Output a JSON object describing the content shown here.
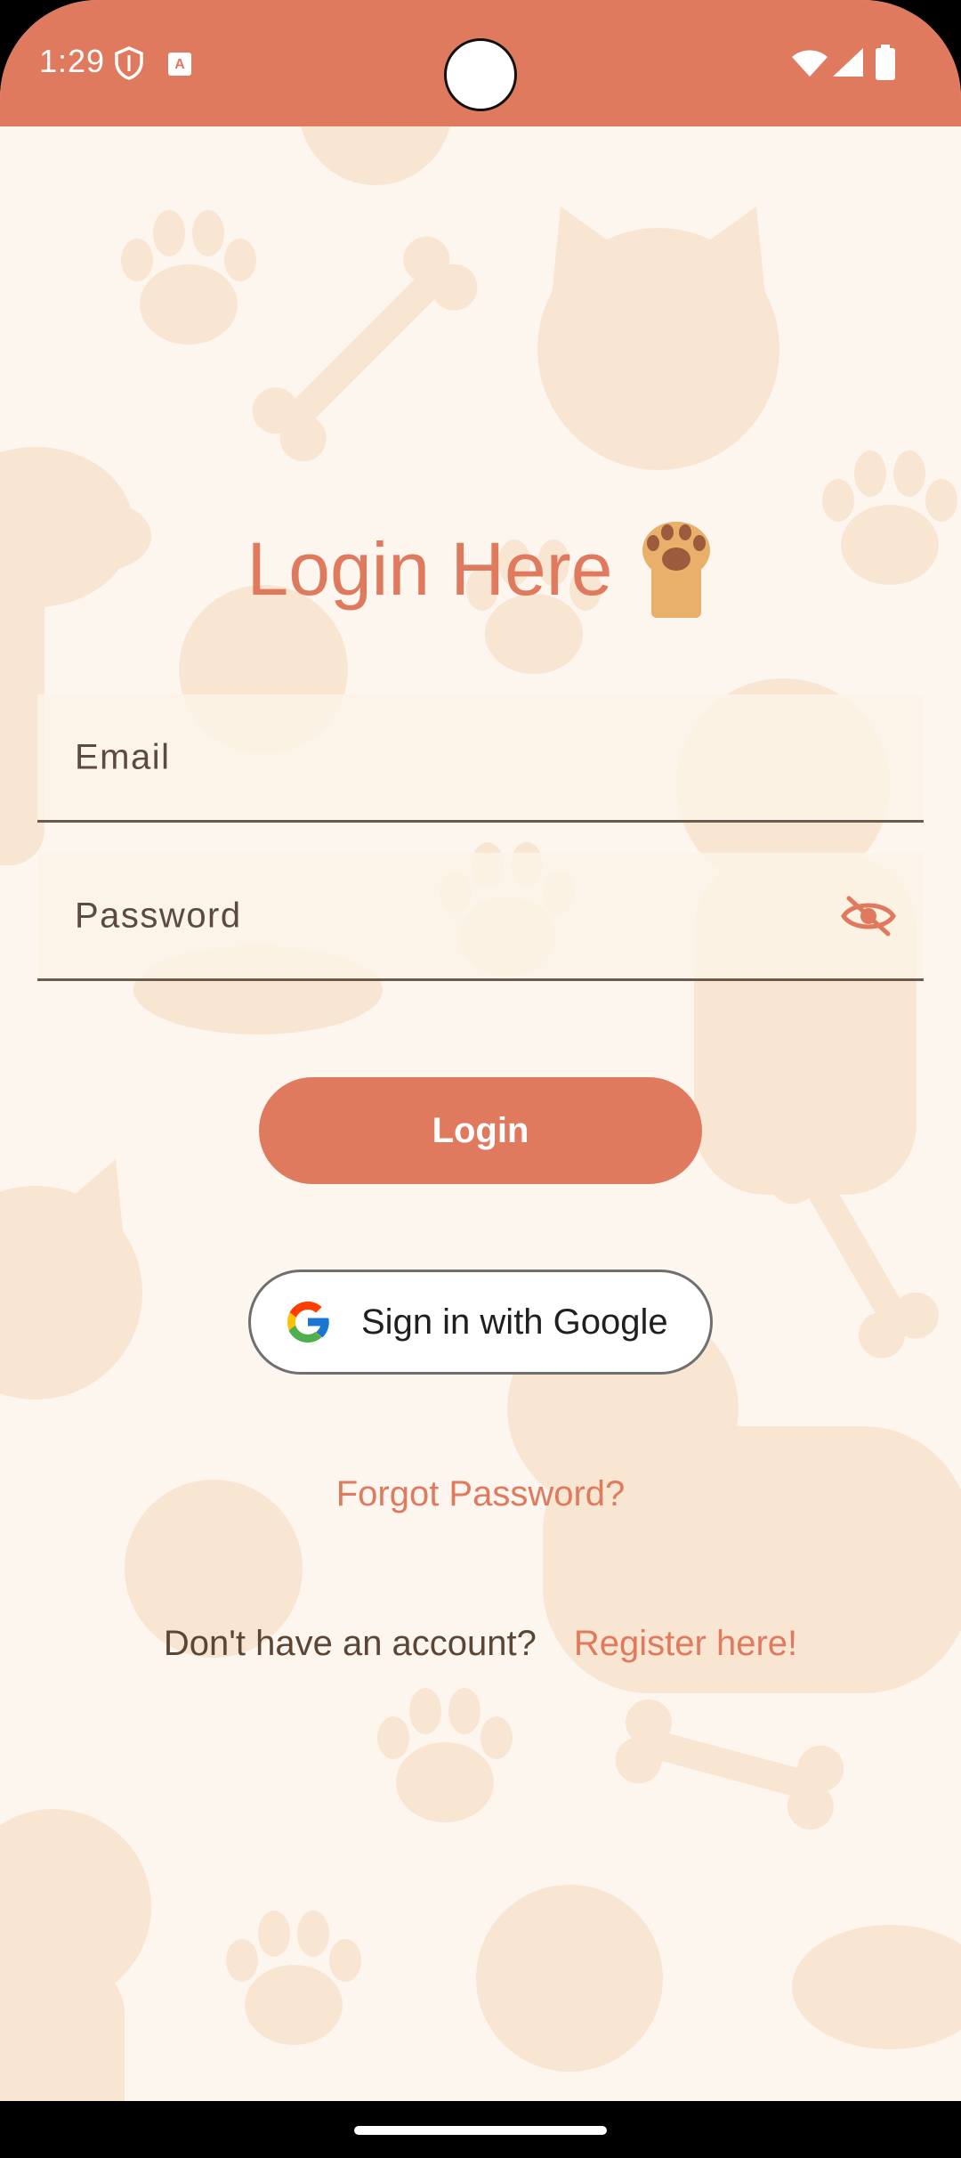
{
  "status_bar": {
    "time": "1:29",
    "background_color": "#e07a5f",
    "icons": [
      "shield-icon",
      "text-notification-icon",
      "wifi-icon",
      "signal-icon",
      "battery-icon"
    ]
  },
  "login": {
    "title": "Login Here",
    "title_icon": "paw-icon",
    "email_label": "Email",
    "email_value": "",
    "password_label": "Password",
    "password_value": "",
    "password_toggle_icon": "eye-off-icon",
    "login_button": "Login",
    "google_button": "Sign in with Google",
    "forgot_password": "Forgot Password?",
    "no_account_text": "Don't have an account?",
    "register_link": "Register here!"
  },
  "colors": {
    "accent": "#e07a5f",
    "background": "#fdf6ef",
    "text_dark": "#5b4636"
  }
}
